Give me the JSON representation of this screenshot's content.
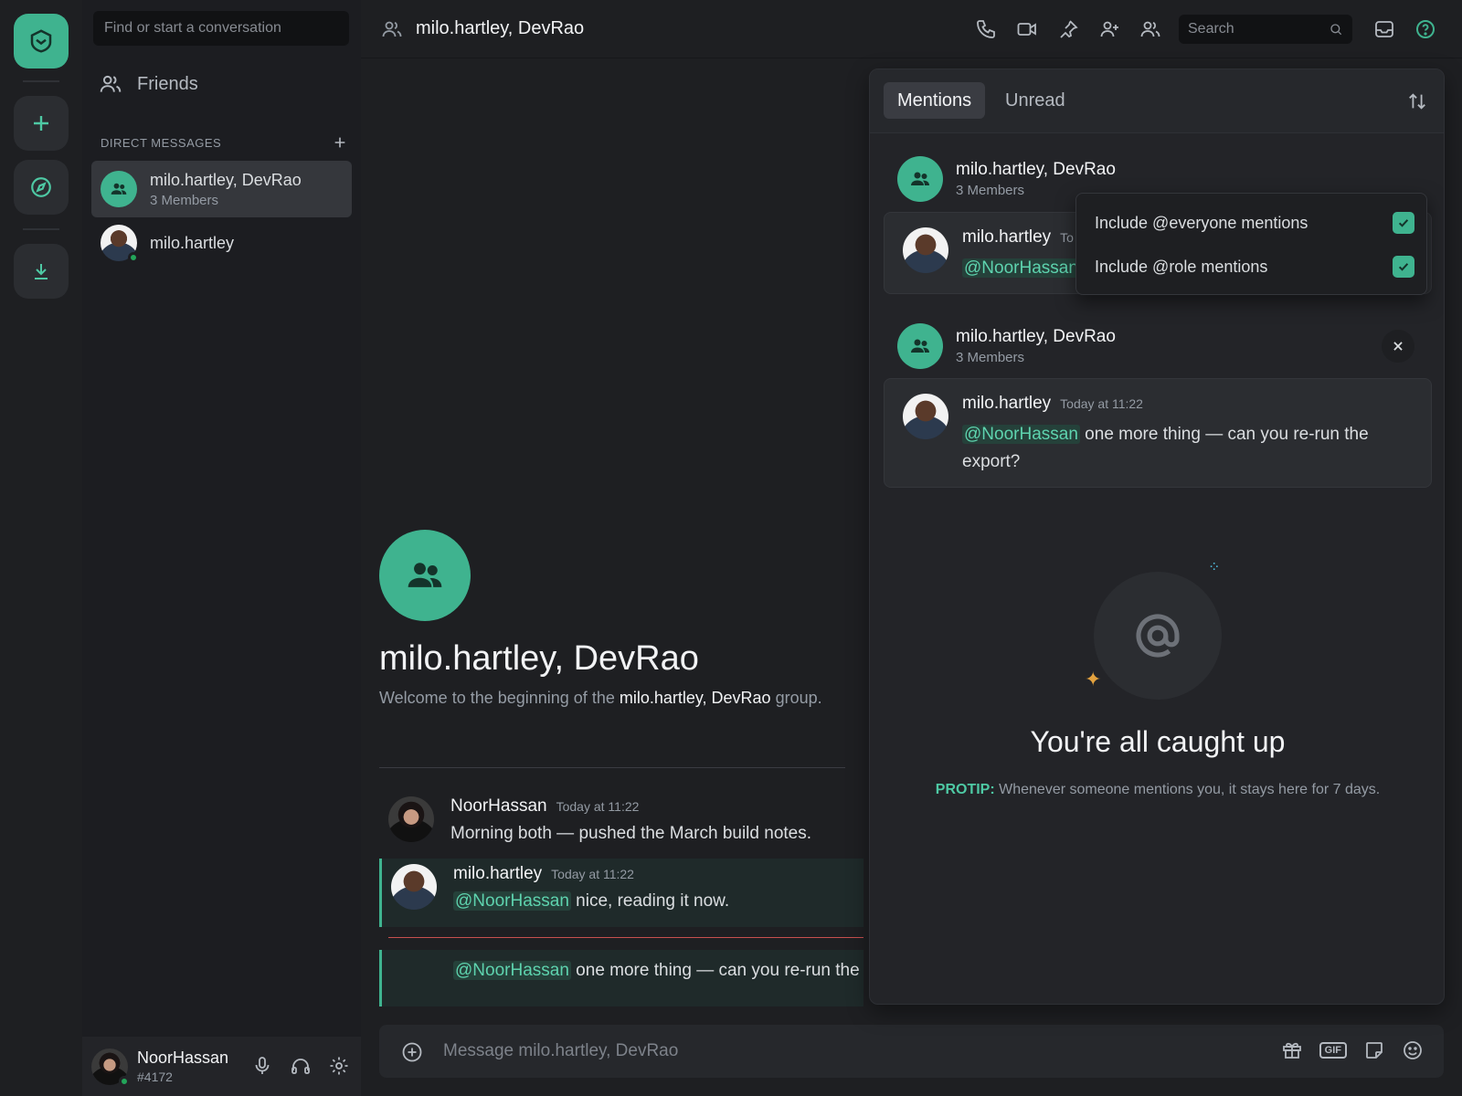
{
  "sidebar": {
    "search_placeholder": "Find or start a conversation",
    "friends_label": "Friends",
    "dm_header": "DIRECT MESSAGES",
    "dms": [
      {
        "name": "milo.hartley, DevRao",
        "sub": "3 Members"
      },
      {
        "name": "milo.hartley",
        "sub": ""
      }
    ]
  },
  "user": {
    "name": "NoorHassan",
    "tag": "#4172"
  },
  "channel": {
    "title": "milo.hartley, DevRao",
    "search_placeholder": "Search"
  },
  "welcome": {
    "title": "milo.hartley, DevRao",
    "sub_prefix": "Welcome to the beginning of the ",
    "sub_name": "milo.hartley, DevRao",
    "sub_suffix": " group."
  },
  "messages": [
    {
      "author": "NoorHassan",
      "time": "Today at 11:22",
      "text": "Morning both — pushed the March build notes."
    },
    {
      "author": "milo.hartley",
      "time": "Today at 11:22",
      "mention": "@NoorHassan",
      "text": " nice, reading it now."
    },
    {
      "mention": "@NoorHassan",
      "text": " one more thing — can you re-run the"
    }
  ],
  "composer": {
    "placeholder": "Message milo.hartley, DevRao",
    "gif_label": "GIF"
  },
  "inbox": {
    "tabs": [
      "Mentions",
      "Unread"
    ],
    "groups": [
      {
        "name": "milo.hartley, DevRao",
        "sub": "3 Members",
        "author": "milo.hartley",
        "time": "To",
        "mention": "@NoorHassan",
        "text": ""
      },
      {
        "name": "milo.hartley, DevRao",
        "sub": "3 Members",
        "author": "milo.hartley",
        "time": "Today at 11:22",
        "mention": "@NoorHassan",
        "text": " one more thing — can you re-run the export?"
      }
    ],
    "filters": [
      {
        "label": "Include @everyone mentions",
        "checked": true
      },
      {
        "label": "Include @role mentions",
        "checked": true
      }
    ],
    "empty_title": "You're all caught up",
    "protip_label": "PROTIP:",
    "protip_text": " Whenever someone mentions you, it stays here for 7 days."
  },
  "colors": {
    "accent": "#3fb38f",
    "mention_text": "#5ed3ae",
    "new_divider": "#c8504f"
  }
}
